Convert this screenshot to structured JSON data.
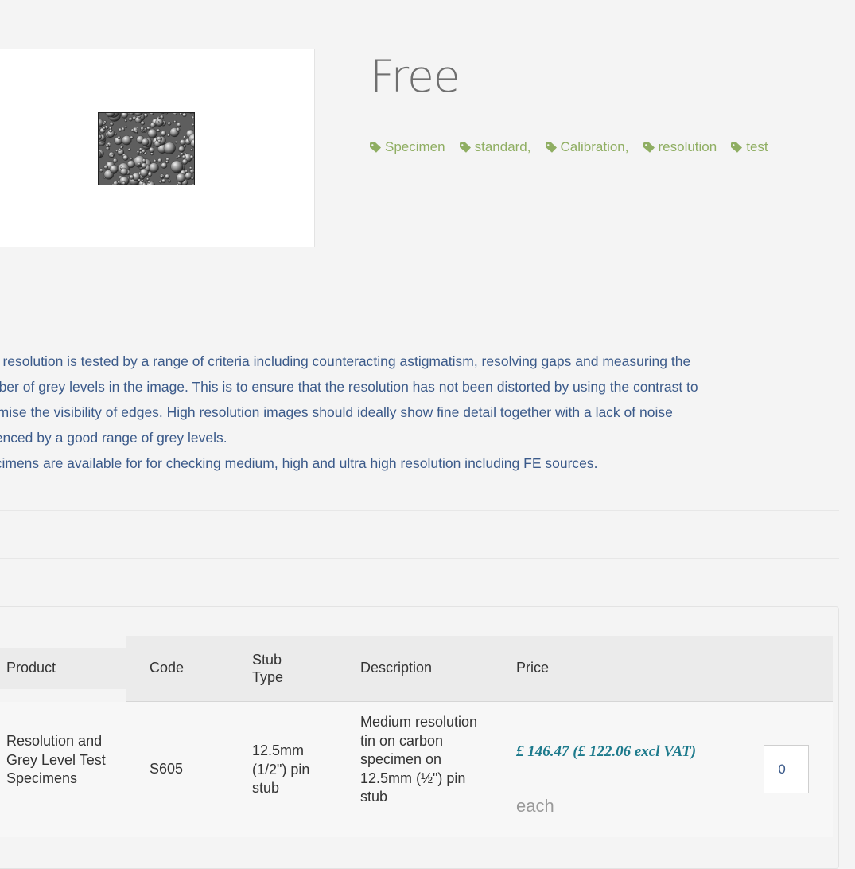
{
  "product": {
    "title": "Free",
    "image_alt": "resolution specimen micrograph"
  },
  "tags": [
    {
      "label": "Specimen",
      "icon": "tag-icon"
    },
    {
      "label": "standard,",
      "icon": "tag-icon"
    },
    {
      "label": "Calibration,",
      "icon": "tag-icon"
    },
    {
      "label": "resolution",
      "icon": "tag-icon"
    },
    {
      "label": "test",
      "icon": "tag-icon"
    }
  ],
  "description": [
    "M resolution is tested by a range of criteria including counteracting astigmatism, resolving gaps and measuring the",
    "mber of grey levels in the image. This is to ensure that the resolution has not been distorted by using the contrast to",
    "ximise the visibility of edges. High resolution images should ideally show fine detail together with a lack of noise",
    "denced by a good range of grey levels.",
    "ecimens are available for for checking medium, high and ultra high resolution including FE sources."
  ],
  "table": {
    "headers": {
      "product": "Product",
      "code": "Code",
      "stub_type": "Stub Type",
      "description": "Description",
      "price": "Price"
    },
    "row": {
      "product": "Resolution and Grey Level Test Specimens",
      "code": "S605",
      "stub_type": "12.5mm (1/2\") pin stub",
      "description": "Medium resolution tin on carbon specimen on 12.5mm (½\") pin stub",
      "price": "£ 146.47 (£ 122.06 excl VAT)",
      "unit": "each",
      "quantity": "0"
    }
  },
  "colors": {
    "background": "#f4f4f4",
    "tag": "#8fae62",
    "description_text": "#3b5a8a",
    "price": "#1d7a8c"
  }
}
